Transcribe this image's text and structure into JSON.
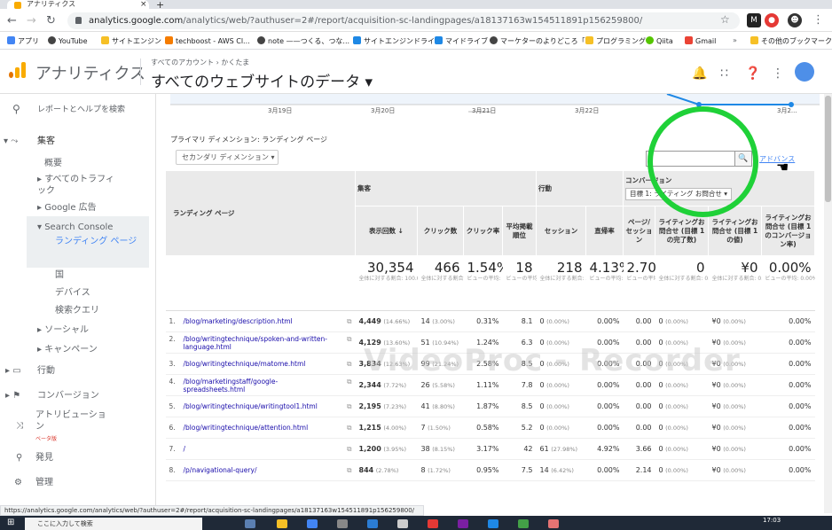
{
  "browser": {
    "tab_title": "アナリティクス",
    "url_host": "analytics.google.com",
    "url_path": "/analytics/web/?authuser=2#/report/acquisition-sc-landingpages/a18137163w154511891p156259800/"
  },
  "bookmarks": [
    "アプリ",
    "YouTube",
    "サイトエンジン",
    "techboost - AWS Cl...",
    "note ——つくる、つな...",
    "サイトエンジンドライブ",
    "マイドライブ",
    "マーケターのよりどころ「I...",
    "プログラミング",
    "Qiita",
    "Gmail",
    "その他のブックマーク"
  ],
  "ga": {
    "app_title": "アナリティクス",
    "breadcrumb": "すべてのアカウント › かくたま",
    "view_title": "すべてのウェブサイトのデータ ▾"
  },
  "sidebar": {
    "search": "レポートとヘルプを検索",
    "acquisition": "集客",
    "overview": "概要",
    "all_traffic": "すべてのトラフィック",
    "google_ads": "Google 広告",
    "search_console": "Search Console",
    "landing_pages": "ランディング ページ",
    "countries": "国",
    "devices": "デバイス",
    "queries": "検索クエリ",
    "social": "ソーシャル",
    "campaigns": "キャンペーン",
    "behavior": "行動",
    "conversions": "コンバージョン",
    "attribution": "アトリビューション",
    "beta": "ベータ版",
    "discover": "発見",
    "admin": "管理"
  },
  "chart": {
    "dates": [
      "3月19日",
      "3月20日",
      "3月21日",
      "3月22日",
      "3月2..."
    ]
  },
  "report": {
    "primary_dimension": "プライマリ ディメンション: ランディング ページ",
    "secondary_dim": "セカンダリ ディメンション ▾",
    "advanced": "アドバンス",
    "search_btn": "🔍"
  },
  "table": {
    "head_landing": "ランディング ページ",
    "grp_acq": "集客",
    "grp_beh": "行動",
    "grp_conv": "コンバージョン",
    "goal_select": "目標 1: ライティング お問合せ ▾",
    "cols": [
      "表示回数",
      "クリック数",
      "クリック率",
      "平均掲載順位",
      "セッション",
      "直帰率",
      "ページ/セッション",
      "ライティングお問合せ (目標 1 の完了数)",
      "ライティングお問合せ (目標 1 の値)",
      "ライティングお問合せ (目標 1 のコンバージョン率)"
    ],
    "totals": {
      "impr": "30,354",
      "impr_sub": "全体に対する割合: 100.00% (30,354)",
      "clicks": "466",
      "clicks_sub": "全体に対する割合: 100.00% (466)",
      "ctr": "1.54%",
      "ctr_sub": "ビューの平均: 1.54% (0.00%)",
      "pos": "18",
      "pos_sub": "ビューの平均: 18 (0.00%)",
      "sess": "218",
      "sess_sub": "全体に対する割合: 34.99% (623)",
      "bounce": "4.13%",
      "bounce_sub": "ビューの平均: 5.30% (-22.06%)",
      "pps": "2.70",
      "pps_sub": "ビューの平均: 2.71 (-0.51%)",
      "gc": "0",
      "gc_sub": "全体に対する割合: 0.00% (0)",
      "gv": "¥0",
      "gv_sub": "全体に対する割合: 0.00% (¥0)",
      "gr": "0.00%",
      "gr_sub": "ビューの平均: 0.00% (0.00%)"
    },
    "rows": [
      {
        "i": "1.",
        "page": "/blog/marketing/description.html",
        "impr": "4,449",
        "ip": "(14.66%)",
        "clk": "14",
        "cp": "(3.00%)",
        "ctr": "0.31%",
        "pos": "8.1",
        "ses": "0",
        "sp": "(0.00%)",
        "br": "0.00%",
        "pps": "0.00",
        "gc": "0",
        "gcp": "(0.00%)",
        "gv": "¥0",
        "gvp": "(0.00%)",
        "gr": "0.00%"
      },
      {
        "i": "2.",
        "page": "/blog/writingtechnique/spoken-and-written-language.html",
        "impr": "4,129",
        "ip": "(13.60%)",
        "clk": "51",
        "cp": "(10.94%)",
        "ctr": "1.24%",
        "pos": "6.3",
        "ses": "0",
        "sp": "(0.00%)",
        "br": "0.00%",
        "pps": "0.00",
        "gc": "0",
        "gcp": "(0.00%)",
        "gv": "¥0",
        "gvp": "(0.00%)",
        "gr": "0.00%"
      },
      {
        "i": "3.",
        "page": "/blog/writingtechnique/matome.html",
        "impr": "3,834",
        "ip": "(12.63%)",
        "clk": "99",
        "cp": "(21.24%)",
        "ctr": "2.58%",
        "pos": "8.5",
        "ses": "0",
        "sp": "(0.00%)",
        "br": "0.00%",
        "pps": "0.00",
        "gc": "0",
        "gcp": "(0.00%)",
        "gv": "¥0",
        "gvp": "(0.00%)",
        "gr": "0.00%"
      },
      {
        "i": "4.",
        "page": "/blog/marketingstaff/google-spreadsheets.html",
        "impr": "2,344",
        "ip": "(7.72%)",
        "clk": "26",
        "cp": "(5.58%)",
        "ctr": "1.11%",
        "pos": "7.8",
        "ses": "0",
        "sp": "(0.00%)",
        "br": "0.00%",
        "pps": "0.00",
        "gc": "0",
        "gcp": "(0.00%)",
        "gv": "¥0",
        "gvp": "(0.00%)",
        "gr": "0.00%"
      },
      {
        "i": "5.",
        "page": "/blog/writingtechnique/writingtool1.html",
        "impr": "2,195",
        "ip": "(7.23%)",
        "clk": "41",
        "cp": "(8.80%)",
        "ctr": "1.87%",
        "pos": "8.5",
        "ses": "0",
        "sp": "(0.00%)",
        "br": "0.00%",
        "pps": "0.00",
        "gc": "0",
        "gcp": "(0.00%)",
        "gv": "¥0",
        "gvp": "(0.00%)",
        "gr": "0.00%"
      },
      {
        "i": "6.",
        "page": "/blog/writingtechnique/attention.html",
        "impr": "1,215",
        "ip": "(4.00%)",
        "clk": "7",
        "cp": "(1.50%)",
        "ctr": "0.58%",
        "pos": "5.2",
        "ses": "0",
        "sp": "(0.00%)",
        "br": "0.00%",
        "pps": "0.00",
        "gc": "0",
        "gcp": "(0.00%)",
        "gv": "¥0",
        "gvp": "(0.00%)",
        "gr": "0.00%"
      },
      {
        "i": "7.",
        "page": "/",
        "impr": "1,200",
        "ip": "(3.95%)",
        "clk": "38",
        "cp": "(8.15%)",
        "ctr": "3.17%",
        "pos": "42",
        "ses": "61",
        "sp": "(27.98%)",
        "br": "4.92%",
        "pps": "3.66",
        "gc": "0",
        "gcp": "(0.00%)",
        "gv": "¥0",
        "gvp": "(0.00%)",
        "gr": "0.00%"
      },
      {
        "i": "8.",
        "page": "/p/navigational-query/",
        "impr": "844",
        "ip": "(2.78%)",
        "clk": "8",
        "cp": "(1.72%)",
        "ctr": "0.95%",
        "pos": "7.5",
        "ses": "14",
        "sp": "(6.42%)",
        "br": "0.00%",
        "pps": "2.14",
        "gc": "0",
        "gcp": "(0.00%)",
        "gv": "¥0",
        "gvp": "(0.00%)",
        "gr": "0.00%"
      }
    ]
  },
  "watermark": "VideoProc - Recorder",
  "status_url": "https://analytics.google.com/analytics/web/?authuser=2#/report/acquisition-sc-landingpages/a18137163w154511891p156259800/",
  "taskbar": {
    "search": "ここに入力して検索",
    "time": "17:03"
  },
  "colors": {
    "ga_orange": "#f9ab00",
    "ga_orange_dark": "#e37400",
    "link": "#1a0dab",
    "highlight": "#1fd138"
  }
}
